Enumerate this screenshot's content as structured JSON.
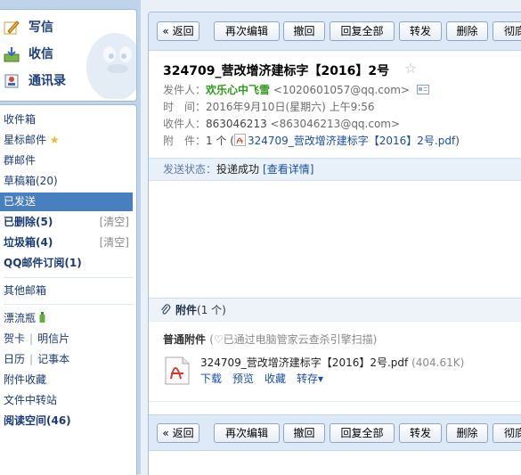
{
  "quick": {
    "compose": "写信",
    "inbox": "收信",
    "contacts": "通讯录"
  },
  "folders": {
    "inbox": "收件箱",
    "starred": "星标邮件",
    "group": "群邮件",
    "drafts": "草稿箱(20)",
    "sent": "已发送",
    "deleted": "已删除(5)",
    "spam": "垃圾箱(4)",
    "clear": "[清空]",
    "subscriptions": "QQ邮件订阅(1)",
    "other": "其他邮箱",
    "drift_bottle": "漂流瓶",
    "greeting_card": "贺卡",
    "postcard": "明信片",
    "calendar": "日历",
    "notepad": "记事本",
    "attachment_box": "附件收藏",
    "file_transfer": "文件中转站",
    "reading_space": "阅读空间(46)"
  },
  "toolbar": {
    "back": "« 返回",
    "edit_again": "再次编辑",
    "recall": "撤回",
    "reply_all": "回复全部",
    "forward": "转发",
    "delete": "删除",
    "delete_perm": "彻底"
  },
  "mail": {
    "subject": "324709_营改增济建标字【2016】2号",
    "sender_label": "发件人：",
    "sender_name": "欢乐心中飞雪",
    "sender_email": "<1020601057@qq.com>",
    "time_label": "时　间：",
    "time_value": "2016年9月10日(星期六) 上午9:56",
    "recipient_label": "收件人：",
    "recipient_value": "863046213",
    "recipient_email": "<863046213@qq.com>",
    "attach_label": "附　件：",
    "attach_count": "1 个 (",
    "attach_file": "324709_营改增济建标字【2016】2号.pdf",
    "attach_close": ")"
  },
  "status": {
    "label": "发送状态：",
    "value": "投递成功",
    "detail": "[查看详情]"
  },
  "attachments": {
    "title": "附件",
    "count": "(1 个)",
    "kind": "普通附件",
    "scan_note": "(♡已通过电脑管家云查杀引擎扫描)",
    "file_name": "324709_营改增济建标字【2016】2号.pdf",
    "file_size": "(404.61K)",
    "download": "下载",
    "preview": "预览",
    "collect": "收藏",
    "save_to": "转存▾"
  },
  "colors": {
    "accent": "#477fc0",
    "sender_green": "#2f9a1b",
    "link": "#1a4fa0"
  }
}
